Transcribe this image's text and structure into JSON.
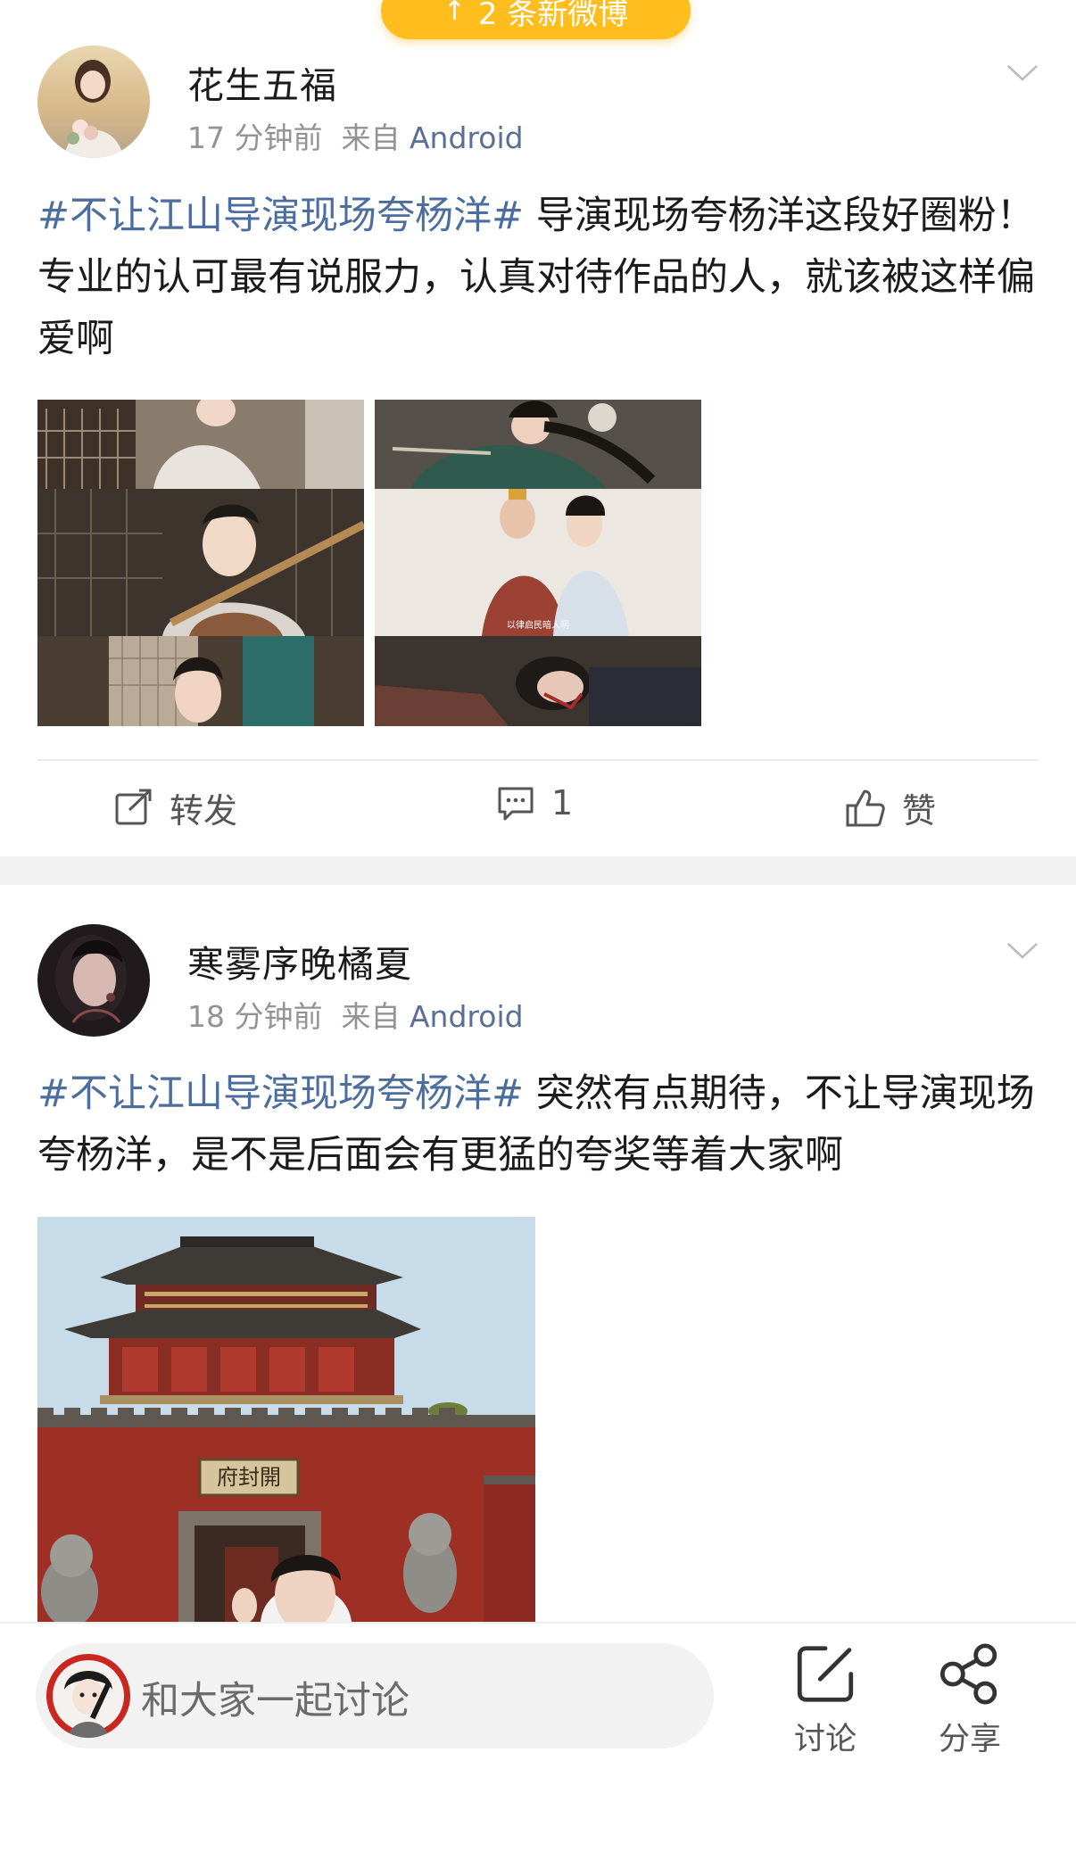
{
  "new_posts_pill": {
    "label": "2 条新微博"
  },
  "posts": [
    {
      "username": "花生五福",
      "time": "17 分钟前",
      "source_prefix": "来自",
      "source": "Android",
      "hashtag": "#不让江山导演现场夸杨洋#",
      "text": " 导演现场夸杨洋这段好圈粉！专业的认可最有说服力，认真对待作品的人，就该被这样偏爱啊",
      "image_caption": "以律启民暗人明",
      "actions": {
        "repost": "转发",
        "comments": "1",
        "like": "赞"
      }
    },
    {
      "username": "寒雾序晚橘夏",
      "time": "18 分钟前",
      "source_prefix": "来自",
      "source": "Android",
      "hashtag": "#不让江山导演现场夸杨洋#",
      "text": " 突然有点期待，不让导演现场夸杨洋，是不是后面会有更猛的夸奖等着大家啊",
      "image_sign": "府封開"
    }
  ],
  "bottom_bar": {
    "placeholder": "和大家一起讨论",
    "discuss_label": "讨论",
    "share_label": "分享"
  },
  "colors": {
    "pill": "#ffbe1e",
    "hashtag": "#4d6d9e",
    "source": "#5a6f93"
  }
}
